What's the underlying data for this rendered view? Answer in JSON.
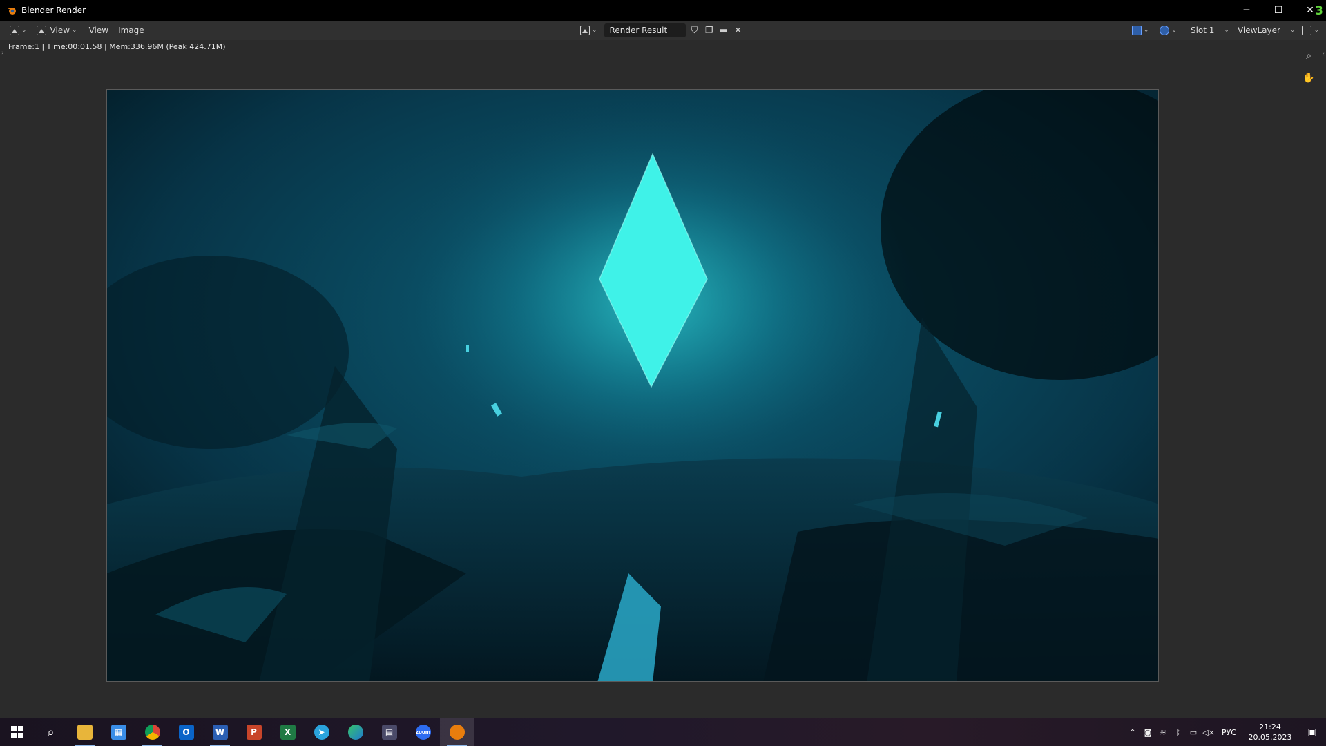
{
  "window": {
    "title": "Blender Render",
    "minimize": "─",
    "maximize": "☐",
    "close": "✕",
    "version_badge": "3"
  },
  "header": {
    "menus": [
      "View",
      "View",
      "Image"
    ],
    "image_name": "Render Result",
    "slot": "Slot 1",
    "view_layer": "ViewLayer"
  },
  "status": {
    "text": "Frame:1 | Time:00:01.58 | Mem:336.96M (Peak 424.71M)"
  },
  "icons": {
    "editor_type": "image-editor-icon",
    "shield": "fake-user-shield-icon",
    "new_image": "new-image-icon",
    "open_image": "folder-icon",
    "unlink": "close-icon",
    "zoom": "zoom-icon",
    "pan": "hand-pan-icon"
  },
  "colors": {
    "accent_glow": "#3ff2e8",
    "scene_dark": "#05222c",
    "blender_orange": "#e87d0d"
  },
  "taskbar": {
    "apps": [
      "windows-start",
      "search",
      "file-explorer",
      "microsoft-store",
      "chrome",
      "outlook",
      "word",
      "powerpoint",
      "excel",
      "telegram",
      "edge",
      "calculator",
      "zoom",
      "blender"
    ],
    "active_app": "blender",
    "language": "РУС",
    "time": "21:24",
    "date": "20.05.2023"
  }
}
